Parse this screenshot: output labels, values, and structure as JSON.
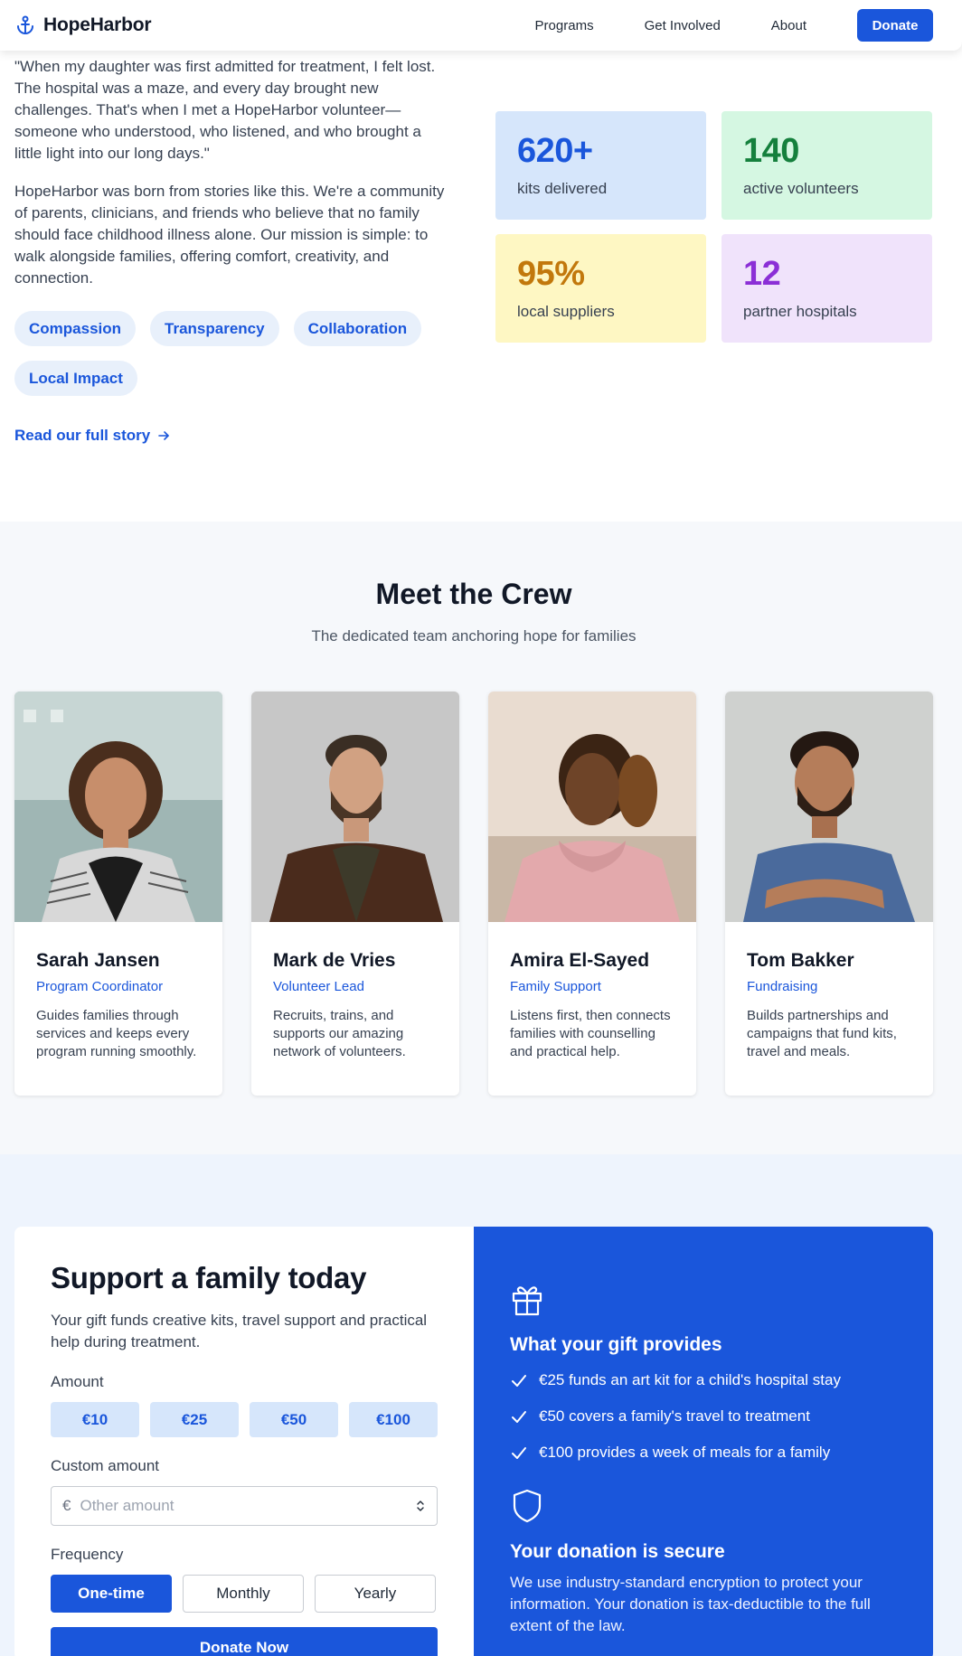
{
  "header": {
    "brand": "HopeHarbor",
    "nav": [
      "Programs",
      "Get Involved",
      "About"
    ],
    "donate_label": "Donate"
  },
  "story": {
    "quote": "\"When my daughter was first admitted for treatment, I felt lost. The hospital was a maze, and every day brought new challenges. That's when I met a HopeHarbor volunteer—someone who understood, who listened, and who brought a little light into our long days.\"",
    "mission": "HopeHarbor was born from stories like this. We're a community of parents, clinicians, and friends who believe that no family should face childhood illness alone. Our mission is simple: to walk alongside families, offering comfort, creativity, and connection.",
    "values": [
      "Compassion",
      "Transparency",
      "Collaboration",
      "Local Impact"
    ],
    "read_more": "Read our full story"
  },
  "stats": [
    {
      "value": "620+",
      "label": "kits delivered",
      "color": "#1a56db"
    },
    {
      "value": "140",
      "label": "active volunteers",
      "color": "#15803d"
    },
    {
      "value": "95%",
      "label": "local suppliers",
      "color": "#c2780c"
    },
    {
      "value": "12",
      "label": "partner hospitals",
      "color": "#8b2fd6"
    }
  ],
  "crew": {
    "title": "Meet the Crew",
    "subtitle": "The dedicated team anchoring hope for families",
    "members": [
      {
        "name": "Sarah Jansen",
        "role": "Program Coordinator",
        "desc": "Guides families through services and keeps every program running smoothly."
      },
      {
        "name": "Mark de Vries",
        "role": "Volunteer Lead",
        "desc": "Recruits, trains, and supports our amazing network of volunteers."
      },
      {
        "name": "Amira El-Sayed",
        "role": "Family Support",
        "desc": "Listens first, then connects families with counselling and practical help."
      },
      {
        "name": "Tom Bakker",
        "role": "Fundraising",
        "desc": "Builds partnerships and campaigns that fund kits, travel and meals."
      }
    ]
  },
  "donate": {
    "title": "Support a family today",
    "subtitle": "Your gift funds creative kits, travel support and practical help during treatment.",
    "amount_label": "Amount",
    "amounts": [
      "€10",
      "€25",
      "€50",
      "€100"
    ],
    "custom_label": "Custom amount",
    "currency_symbol": "€",
    "custom_placeholder": "Other amount",
    "frequency_label": "Frequency",
    "frequencies": [
      "One-time",
      "Monthly",
      "Yearly"
    ],
    "selected_frequency": "One-time",
    "submit_label": "Donate Now",
    "gift_heading": "What your gift provides",
    "benefits": [
      "€25 funds an art kit for a child's hospital stay",
      "€50 covers a family's travel to treatment",
      "€100 provides a week of meals for a family"
    ],
    "secure_heading": "Your donation is secure",
    "secure_text": "We use industry-standard encryption to protect your information. Your donation is tax-deductible to the full extent of the law."
  },
  "colors": {
    "primary": "#1a56db",
    "crew_bg": "#f6f8fb",
    "donate_bg": "#eef4fd"
  },
  "icons": [
    "anchor-icon",
    "arrow-right-icon",
    "gift-icon",
    "check-icon",
    "shield-icon",
    "spinner-arrows-icon"
  ]
}
